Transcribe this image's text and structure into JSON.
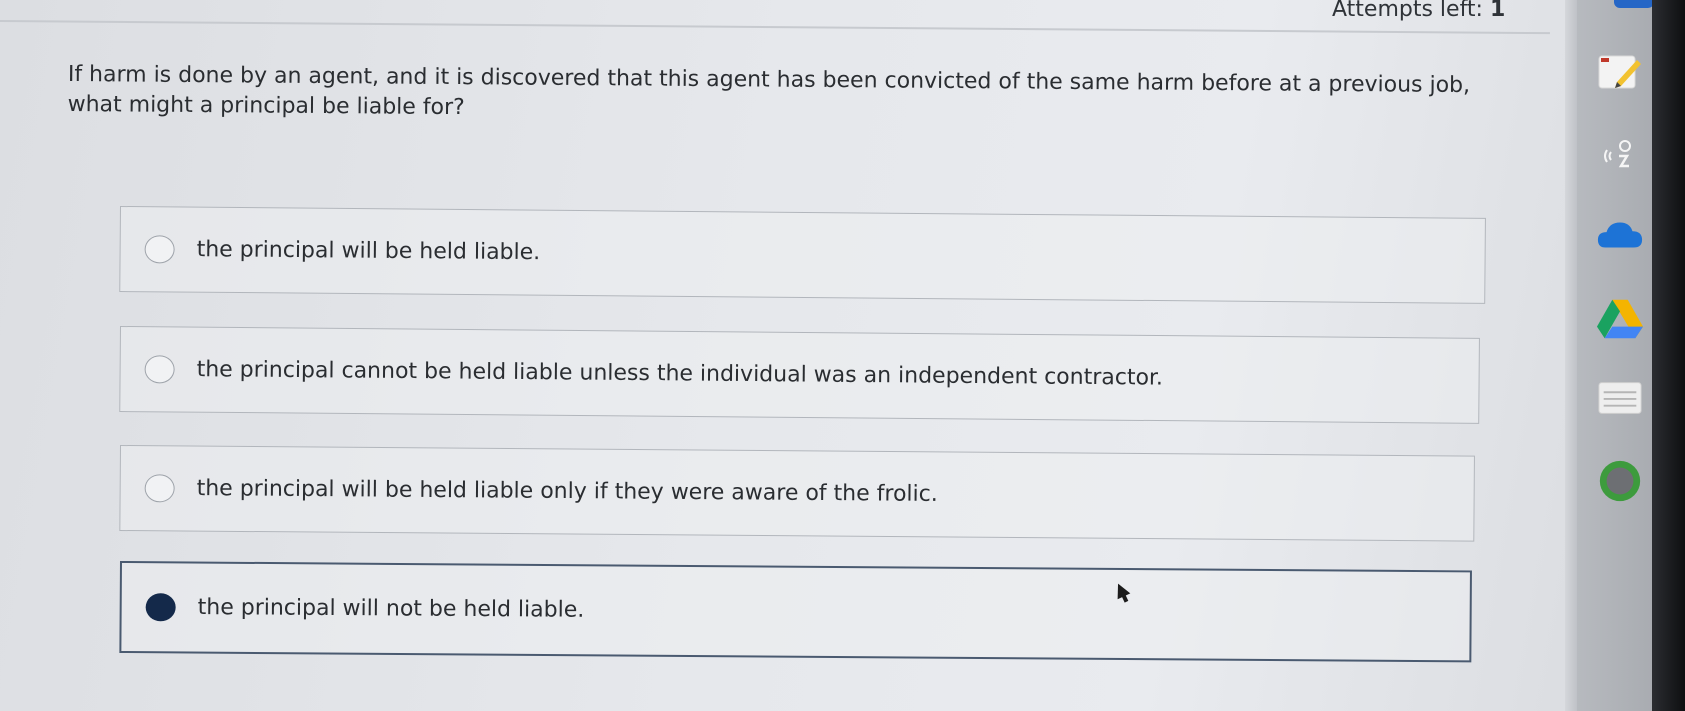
{
  "header": {
    "attempts_label": "Attempts left:",
    "attempts_value": "1"
  },
  "question": {
    "text": "If harm is done by an agent, and it is discovered that this agent has been convicted of the same harm before at a previous job, what might a principal be liable for?"
  },
  "options": [
    {
      "label": "the principal will be held liable.",
      "selected": false
    },
    {
      "label": "the principal cannot be held liable unless the individual was an independent contractor.",
      "selected": false
    },
    {
      "label": "the principal will be held liable only if they were aware of the frolic.",
      "selected": false
    },
    {
      "label": "the principal will not be held liable.",
      "selected": true
    }
  ],
  "dock": {
    "icons": [
      "annotate-pen-icon",
      "cast-voice-icon",
      "onedrive-cloud-icon",
      "google-drive-icon",
      "notes-app-icon",
      "circle-app-icon"
    ]
  },
  "colors": {
    "selected_radio": "#14294a",
    "selected_border": "#4a5a70",
    "onedrive_blue": "#1d73d6",
    "drive_green": "#1aa260",
    "drive_yellow": "#f4b400",
    "drive_blue": "#4285f4"
  }
}
